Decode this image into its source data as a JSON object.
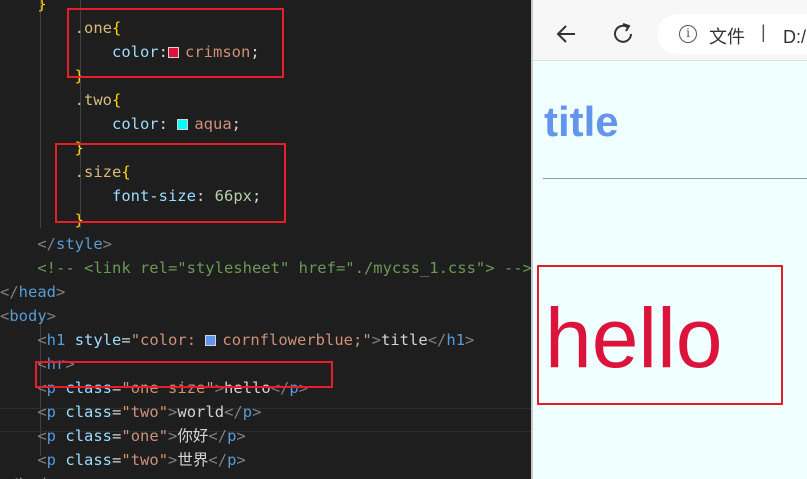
{
  "editor": {
    "lines": [
      {
        "parts": [
          {
            "t": "    ",
            "c": "text"
          },
          {
            "t": "}",
            "c": "brace"
          }
        ]
      },
      {
        "parts": [
          {
            "t": "        ",
            "c": "text"
          },
          {
            "t": ".one",
            "c": "sel"
          },
          {
            "t": "{",
            "c": "brace"
          }
        ]
      },
      {
        "parts": [
          {
            "t": "            ",
            "c": "text"
          },
          {
            "t": "color",
            "c": "prop"
          },
          {
            "t": ":",
            "c": "text"
          },
          {
            "swatch": "#dc143c"
          },
          {
            "t": "crimson",
            "c": "val"
          },
          {
            "t": ";",
            "c": "text"
          }
        ]
      },
      {
        "parts": [
          {
            "t": "        ",
            "c": "text"
          },
          {
            "t": "}",
            "c": "brace"
          }
        ]
      },
      {
        "parts": [
          {
            "t": "        ",
            "c": "text"
          },
          {
            "t": ".two",
            "c": "sel"
          },
          {
            "t": "{",
            "c": "brace"
          }
        ]
      },
      {
        "parts": [
          {
            "t": "            ",
            "c": "text"
          },
          {
            "t": "color",
            "c": "prop"
          },
          {
            "t": ": ",
            "c": "text"
          },
          {
            "swatch": "#00ffff"
          },
          {
            "t": "aqua",
            "c": "val"
          },
          {
            "t": ";",
            "c": "text"
          }
        ]
      },
      {
        "parts": [
          {
            "t": "        ",
            "c": "text"
          },
          {
            "t": "}",
            "c": "brace"
          }
        ]
      },
      {
        "parts": [
          {
            "t": "        ",
            "c": "text"
          },
          {
            "t": ".size",
            "c": "sel"
          },
          {
            "t": "{",
            "c": "brace"
          }
        ]
      },
      {
        "parts": [
          {
            "t": "            ",
            "c": "text"
          },
          {
            "t": "font-size",
            "c": "prop"
          },
          {
            "t": ": ",
            "c": "text"
          },
          {
            "t": "66px",
            "c": "num"
          },
          {
            "t": ";",
            "c": "text"
          }
        ]
      },
      {
        "parts": [
          {
            "t": "        ",
            "c": "text"
          },
          {
            "t": "}",
            "c": "brace"
          }
        ]
      },
      {
        "parts": [
          {
            "t": "    ",
            "c": "text"
          },
          {
            "t": "</",
            "c": "tagb"
          },
          {
            "t": "style",
            "c": "tagc"
          },
          {
            "t": ">",
            "c": "tagb"
          }
        ]
      },
      {
        "parts": [
          {
            "t": "    ",
            "c": "text"
          },
          {
            "t": "<!-- <link rel=\"stylesheet\" href=\"./mycss_1.css\"> -->",
            "c": "comment"
          }
        ]
      },
      {
        "parts": [
          {
            "t": "</",
            "c": "tagb"
          },
          {
            "t": "head",
            "c": "tagc"
          },
          {
            "t": ">",
            "c": "tagb"
          }
        ]
      },
      {
        "parts": [
          {
            "t": "<",
            "c": "tagb"
          },
          {
            "t": "body",
            "c": "tagc"
          },
          {
            "t": ">",
            "c": "tagb"
          }
        ]
      },
      {
        "parts": [
          {
            "t": "    ",
            "c": "text"
          },
          {
            "t": "<",
            "c": "tagb"
          },
          {
            "t": "h1",
            "c": "tagc"
          },
          {
            "t": " ",
            "c": "text"
          },
          {
            "t": "style",
            "c": "attr"
          },
          {
            "t": "=",
            "c": "text"
          },
          {
            "t": "\"color: ",
            "c": "str"
          },
          {
            "swatch": "#6495ed"
          },
          {
            "t": "cornflowerblue;\"",
            "c": "str"
          },
          {
            "t": ">",
            "c": "tagb"
          },
          {
            "t": "title",
            "c": "text"
          },
          {
            "t": "</",
            "c": "tagb"
          },
          {
            "t": "h1",
            "c": "tagc"
          },
          {
            "t": ">",
            "c": "tagb"
          }
        ]
      },
      {
        "parts": [
          {
            "t": "    ",
            "c": "text"
          },
          {
            "t": "<",
            "c": "tagb"
          },
          {
            "t": "hr",
            "c": "tagc"
          },
          {
            "t": ">",
            "c": "tagb"
          }
        ]
      },
      {
        "parts": [
          {
            "t": "    ",
            "c": "text"
          },
          {
            "t": "<",
            "c": "tagb"
          },
          {
            "t": "p",
            "c": "tagc"
          },
          {
            "t": " ",
            "c": "text"
          },
          {
            "t": "class",
            "c": "attr"
          },
          {
            "t": "=",
            "c": "text"
          },
          {
            "t": "\"one size\"",
            "c": "str"
          },
          {
            "t": ">",
            "c": "tagb"
          },
          {
            "t": "hello",
            "c": "text"
          },
          {
            "t": "</",
            "c": "tagb"
          },
          {
            "t": "p",
            "c": "tagc"
          },
          {
            "t": ">",
            "c": "tagb"
          }
        ]
      },
      {
        "parts": [
          {
            "t": "    ",
            "c": "text"
          },
          {
            "t": "<",
            "c": "tagb"
          },
          {
            "t": "p",
            "c": "tagc"
          },
          {
            "t": " ",
            "c": "text"
          },
          {
            "t": "class",
            "c": "attr"
          },
          {
            "t": "=",
            "c": "text"
          },
          {
            "t": "\"two\"",
            "c": "str"
          },
          {
            "t": ">",
            "c": "tagb"
          },
          {
            "t": "world",
            "c": "text"
          },
          {
            "t": "</",
            "c": "tagb"
          },
          {
            "t": "p",
            "c": "tagc"
          },
          {
            "t": ">",
            "c": "tagb"
          }
        ]
      },
      {
        "parts": [
          {
            "t": "    ",
            "c": "text"
          },
          {
            "t": "<",
            "c": "tagb"
          },
          {
            "t": "p",
            "c": "tagc"
          },
          {
            "t": " ",
            "c": "text"
          },
          {
            "t": "class",
            "c": "attr"
          },
          {
            "t": "=",
            "c": "text"
          },
          {
            "t": "\"one\"",
            "c": "str"
          },
          {
            "t": ">",
            "c": "tagb"
          },
          {
            "t": "你好",
            "c": "text"
          },
          {
            "t": "</",
            "c": "tagb"
          },
          {
            "t": "p",
            "c": "tagc"
          },
          {
            "t": ">",
            "c": "tagb"
          }
        ]
      },
      {
        "parts": [
          {
            "t": "    ",
            "c": "text"
          },
          {
            "t": "<",
            "c": "tagb"
          },
          {
            "t": "p",
            "c": "tagc"
          },
          {
            "t": " ",
            "c": "text"
          },
          {
            "t": "class",
            "c": "attr"
          },
          {
            "t": "=",
            "c": "text"
          },
          {
            "t": "\"two\"",
            "c": "str"
          },
          {
            "t": ">",
            "c": "tagb"
          },
          {
            "t": "世界",
            "c": "text"
          },
          {
            "t": "</",
            "c": "tagb"
          },
          {
            "t": "p",
            "c": "tagc"
          },
          {
            "t": ">",
            "c": "tagb"
          }
        ]
      },
      {
        "parts": [
          {
            "t": "</",
            "c": "tagb"
          },
          {
            "t": "body",
            "c": "tagc"
          },
          {
            "t": ">",
            "c": "tagb"
          }
        ]
      }
    ]
  },
  "browser": {
    "address_label": "文件",
    "address_separator": "|",
    "address_url": "D:/网",
    "page": {
      "h1": "title",
      "p": "hello"
    }
  },
  "colors": {
    "crimson": "#dc143c",
    "aqua": "#00ffff",
    "cornflowerblue": "#6495ed",
    "annotation_red": "#e51e2a"
  },
  "icons": [
    "back-arrow-icon",
    "reload-icon",
    "info-icon",
    "color-swatch-icon"
  ]
}
